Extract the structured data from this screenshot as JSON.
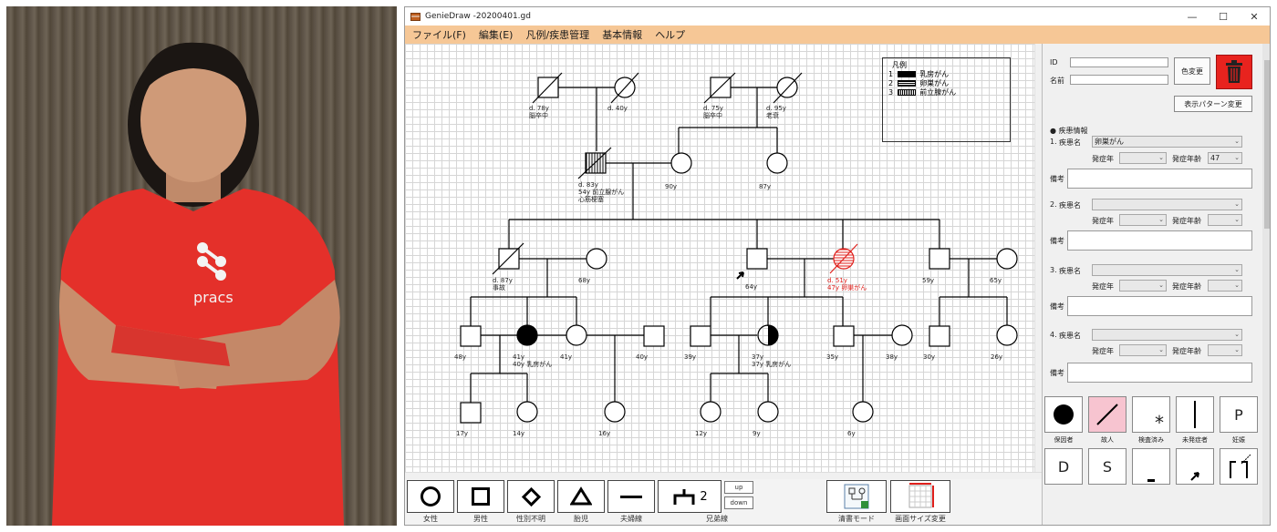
{
  "window": {
    "title": "GenieDraw -20200401.gd",
    "minimize": "—",
    "maximize": "☐",
    "close": "✕"
  },
  "menu": [
    "ファイル(F)",
    "編集(E)",
    "凡例/疾患管理",
    "基本情報",
    "ヘルプ"
  ],
  "photo": {
    "shirt_text": "pracs"
  },
  "legend": {
    "title": "凡例",
    "items": [
      {
        "num": "1",
        "pattern": "solid",
        "label": "乳房がん"
      },
      {
        "num": "2",
        "pattern": "horizontal",
        "label": "卵巣がん"
      },
      {
        "num": "3",
        "pattern": "vertical",
        "label": "前立腺がん"
      }
    ]
  },
  "pedigree_labels": {
    "g1_m1": [
      "d. 78y",
      "脳卒中"
    ],
    "g1_f1": [
      "d. 40y"
    ],
    "g1_m2": [
      "d. 75y",
      "脳卒中"
    ],
    "g1_f2": [
      "d. 95y",
      "老衰"
    ],
    "g2_m": [
      "d. 83y",
      "54y 前立腺がん",
      "心筋梗塞"
    ],
    "g2_f": [
      "90y"
    ],
    "g2_f2": [
      "87y"
    ],
    "g3_m1": [
      "d. 87y",
      "事故"
    ],
    "g3_f1": [
      "68y"
    ],
    "g3_m2": [
      "64y"
    ],
    "g3_f2": [
      "d. 51y",
      "47y 卵巣がん"
    ],
    "g3_m3": [
      "59y"
    ],
    "g3_f3": [
      "65y"
    ],
    "g4_1": [
      "48y"
    ],
    "g4_2": [
      "41y",
      "40y 乳房がん"
    ],
    "g4_3": [
      "41y"
    ],
    "g4_4": [
      "40y"
    ],
    "g4_5": [
      "39y"
    ],
    "g4_6": [
      "37y",
      "37y 乳房がん"
    ],
    "g4_7": [
      "35y"
    ],
    "g4_8": [
      "38y"
    ],
    "g4_9": [
      "30y"
    ],
    "g4_10": [
      "26y"
    ],
    "g5_1": [
      "17y"
    ],
    "g5_2": [
      "14y"
    ],
    "g5_3": [
      "16y"
    ],
    "g5_4": [
      "12y"
    ],
    "g5_5": [
      "9y"
    ],
    "g5_6": [
      "6y"
    ]
  },
  "panel": {
    "id_label": "ID",
    "name_label": "名前",
    "color_change": "色変更",
    "pattern_change": "表示パターン変更",
    "disease_info": "● 疾患情報",
    "diseases": [
      {
        "num": "1.",
        "name_label": "疾患名",
        "name_value": "卵巣がん",
        "year_label": "発症年",
        "age_label": "発症年齢",
        "age_value": "47",
        "note_label": "備考"
      },
      {
        "num": "2.",
        "name_label": "疾患名",
        "name_value": "",
        "year_label": "発症年",
        "age_label": "発症年齢",
        "age_value": "",
        "note_label": "備考"
      },
      {
        "num": "3.",
        "name_label": "疾患名",
        "name_value": "",
        "year_label": "発症年",
        "age_label": "発症年齢",
        "age_value": "",
        "note_label": "備考"
      },
      {
        "num": "4.",
        "name_label": "疾患名",
        "name_value": "",
        "year_label": "発症年",
        "age_label": "発症年齢",
        "age_value": "",
        "note_label": "備考"
      }
    ],
    "symbols": [
      {
        "label": "保因者",
        "glyph": "●"
      },
      {
        "label": "故人",
        "glyph": "/"
      },
      {
        "label": "検査済み",
        "glyph": "*"
      },
      {
        "label": "未発症者",
        "glyph": "|"
      },
      {
        "label": "妊娠",
        "glyph": "P"
      }
    ],
    "symbols_row2": [
      "D",
      "S"
    ]
  },
  "toolbar": {
    "tools": [
      {
        "label": "女性"
      },
      {
        "label": "男性"
      },
      {
        "label": "性別不明"
      },
      {
        "label": "胎児"
      },
      {
        "label": "夫婦線"
      },
      {
        "label": "兄弟線",
        "count": "2"
      }
    ],
    "up": "up",
    "down": "down",
    "clean_mode": "清書モード",
    "canvas_size": "画面サイズ変更"
  },
  "colors": {
    "menu_bg": "#f6c796",
    "affected_red": "#e0201c",
    "trash_red": "#e8231e"
  }
}
